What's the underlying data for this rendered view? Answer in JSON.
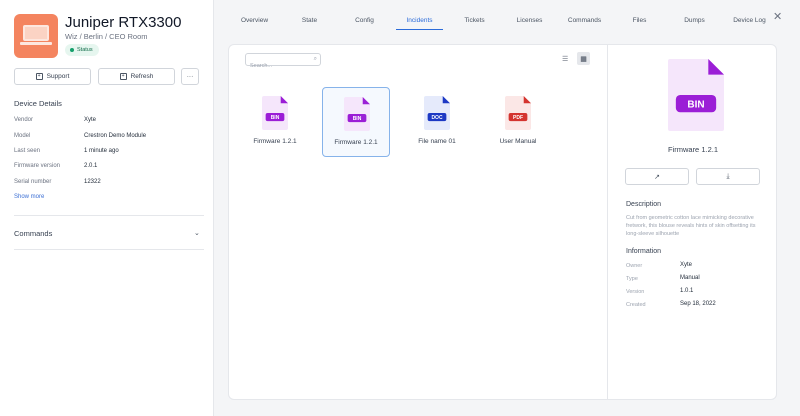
{
  "device": {
    "name": "Juniper RTX3300",
    "location": "Wiz / Berlin / CEO Room",
    "status": "Status"
  },
  "actions": {
    "support": "Support",
    "refresh": "Refresh",
    "more": "···"
  },
  "details": {
    "title": "Device Details",
    "rows": [
      {
        "label": "Vendor",
        "value": "Xyte"
      },
      {
        "label": "Model",
        "value": "Crestron Demo Module"
      },
      {
        "label": "Last seen",
        "value": "1 minute ago"
      },
      {
        "label": "Firmware version",
        "value": "2.0.1"
      },
      {
        "label": "Serial number",
        "value": "12322"
      }
    ],
    "show_more": "Show more"
  },
  "commands": {
    "title": "Commands"
  },
  "tabs": [
    {
      "label": "Overview"
    },
    {
      "label": "State"
    },
    {
      "label": "Config"
    },
    {
      "label": "Incidents",
      "active": true
    },
    {
      "label": "Tickets"
    },
    {
      "label": "Licenses"
    },
    {
      "label": "Commands"
    },
    {
      "label": "Files"
    },
    {
      "label": "Dumps"
    },
    {
      "label": "Device Log"
    }
  ],
  "search": {
    "placeholder": "Search...",
    "value": ""
  },
  "files": [
    {
      "name": "Firmware 1.2.1",
      "type": "BIN",
      "color": "#9b1ed6",
      "bg": "#f5e6fb"
    },
    {
      "name": "Firmware 1.2.1",
      "type": "BIN",
      "color": "#9b1ed6",
      "bg": "#f5e6fb",
      "selected": true
    },
    {
      "name": "File name 01",
      "type": "DOC",
      "color": "#1d39c4",
      "bg": "#e5eafb"
    },
    {
      "name": "User Manual",
      "type": "PDF",
      "color": "#d4342f",
      "bg": "#fbe7e6"
    }
  ],
  "selected_file": {
    "name": "Firmware 1.2.1",
    "type": "BIN",
    "description_title": "Description",
    "description": "Cut from geometric cotton lace mimicking decorative fretwork, this blouse reveals hints of skin offsetting its long-sleeve silhouette",
    "info_title": "Information",
    "info": [
      {
        "label": "Owner",
        "value": "Xyte"
      },
      {
        "label": "Type",
        "value": "Manual"
      },
      {
        "label": "Version",
        "value": "1.0.1"
      },
      {
        "label": "Created",
        "value": "Sep 18, 2022"
      }
    ]
  },
  "colors": {
    "accent": "#2b6bd9",
    "status_green": "#14a06b",
    "bin": "#9b1ed6",
    "doc": "#1d39c4",
    "pdf": "#d4342f"
  },
  "icons": [
    "laptop-thumbnail",
    "support-icon",
    "refresh-icon",
    "more-icon",
    "chevron-down-icon",
    "close-icon",
    "search-icon",
    "list-view-icon",
    "grid-view-icon",
    "open-external-icon",
    "download-icon",
    "file-icon"
  ]
}
